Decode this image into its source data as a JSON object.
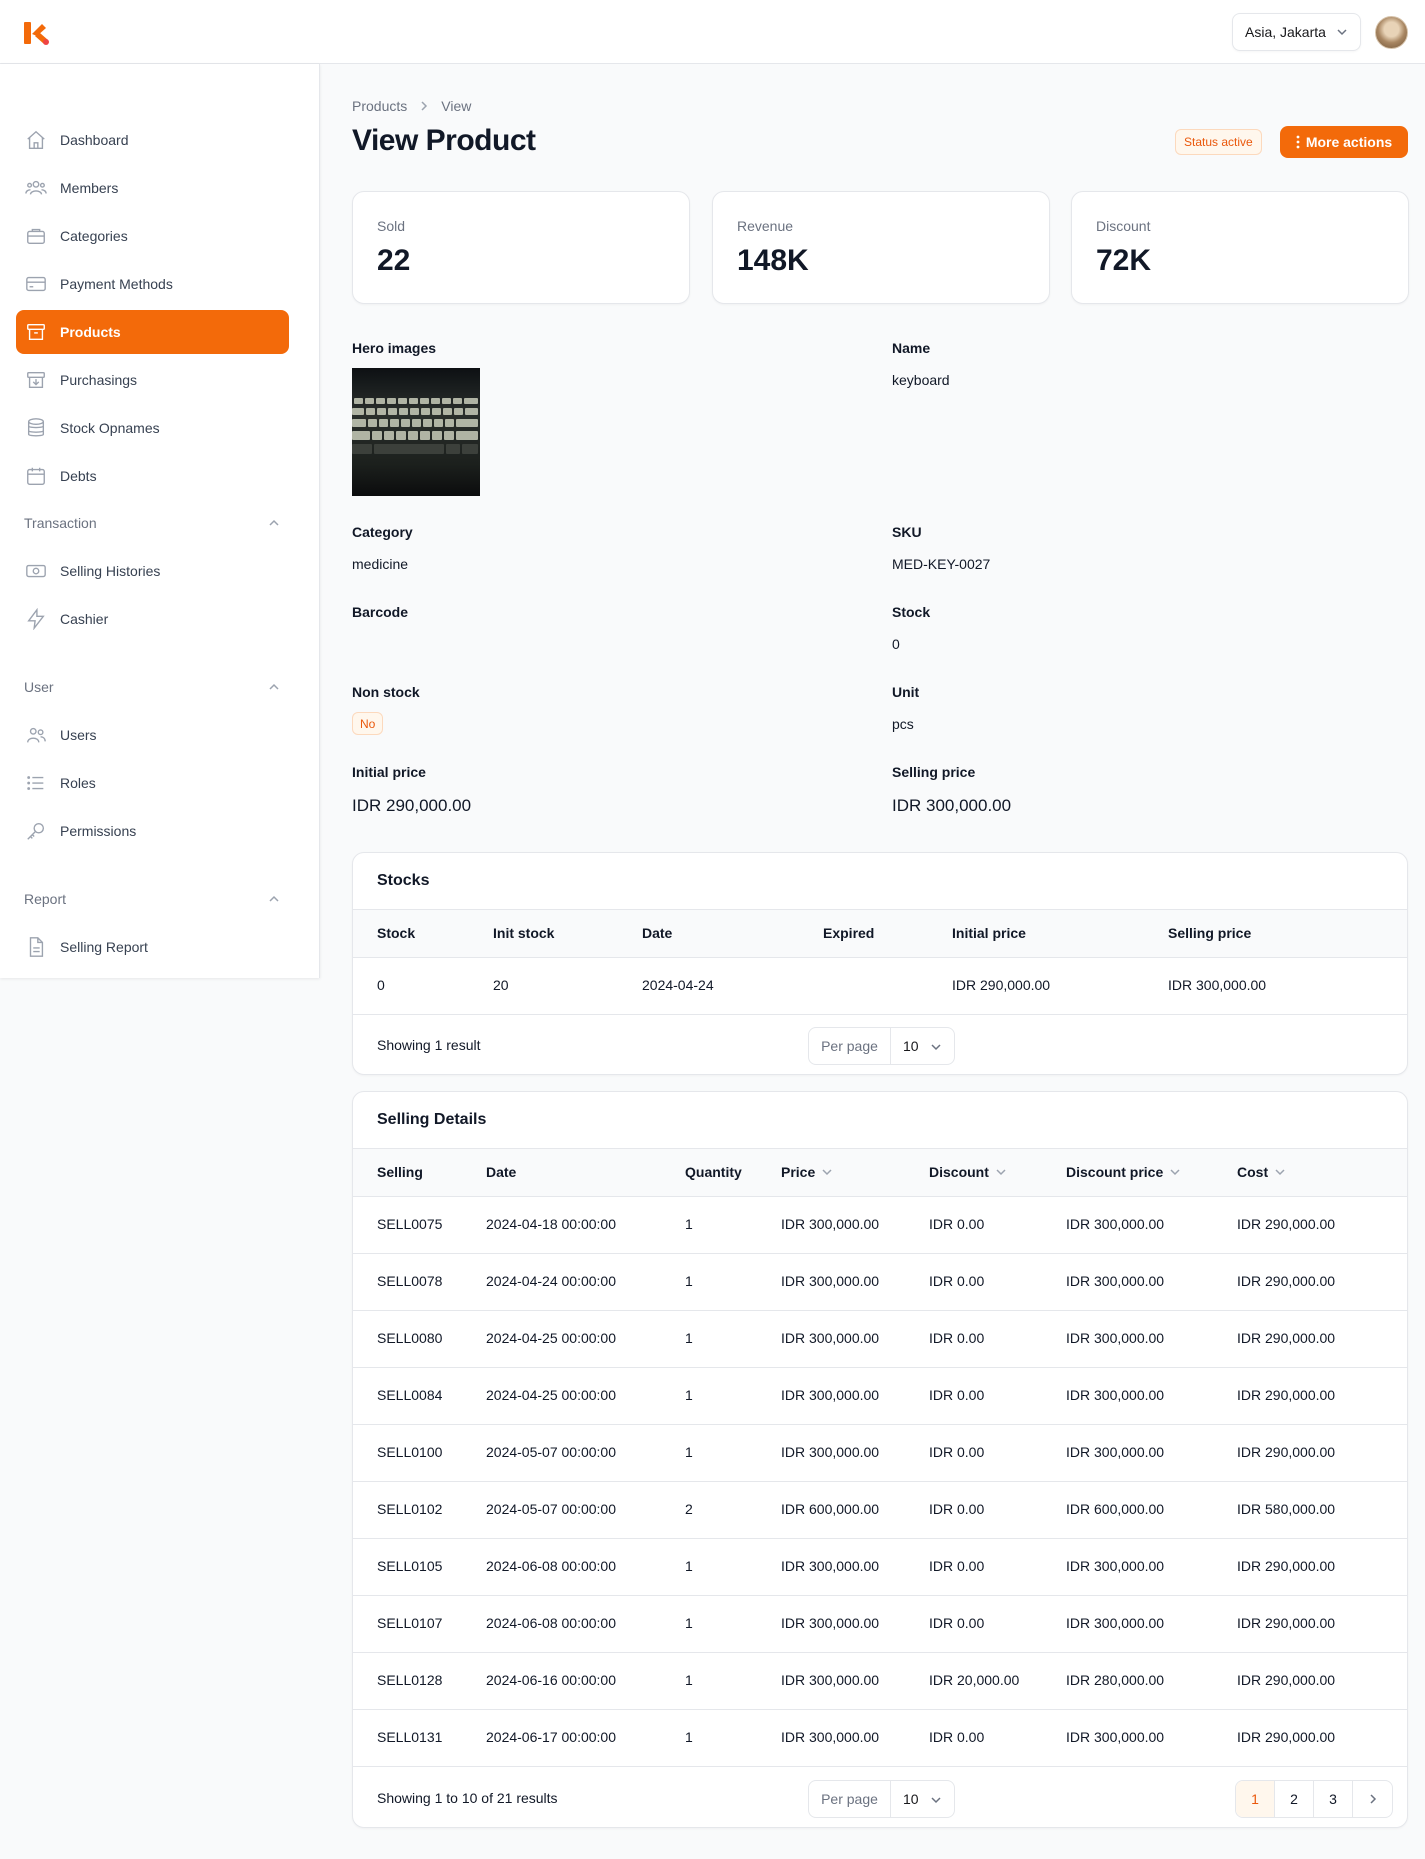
{
  "topbar": {
    "timezone": "Asia, Jakarta"
  },
  "sidebar": {
    "items": [
      {
        "label": "Dashboard"
      },
      {
        "label": "Members"
      },
      {
        "label": "Categories"
      },
      {
        "label": "Payment Methods"
      },
      {
        "label": "Products"
      },
      {
        "label": "Purchasings"
      },
      {
        "label": "Stock Opnames"
      },
      {
        "label": "Debts"
      }
    ],
    "groups": [
      {
        "label": "Transaction",
        "items": [
          {
            "label": "Selling Histories"
          },
          {
            "label": "Cashier"
          }
        ]
      },
      {
        "label": "User",
        "items": [
          {
            "label": "Users"
          },
          {
            "label": "Roles"
          },
          {
            "label": "Permissions"
          }
        ]
      },
      {
        "label": "Report",
        "items": [
          {
            "label": "Selling Report"
          }
        ]
      }
    ],
    "active": "Products",
    "accent": "#f36a0a"
  },
  "breadcrumb": [
    "Products",
    "View"
  ],
  "page": {
    "title": "View Product",
    "status_badge": "Status active",
    "more_actions": "More actions"
  },
  "stats": [
    {
      "label": "Sold",
      "value": "22"
    },
    {
      "label": "Revenue",
      "value": "148K"
    },
    {
      "label": "Discount",
      "value": "72K"
    }
  ],
  "details": {
    "hero_label": "Hero images",
    "name_label": "Name",
    "name": "keyboard",
    "category_label": "Category",
    "category": "medicine",
    "sku_label": "SKU",
    "sku": "MED-KEY-0027",
    "barcode_label": "Barcode",
    "barcode": "",
    "stock_label": "Stock",
    "stock": "0",
    "non_stock_label": "Non stock",
    "non_stock": "No",
    "unit_label": "Unit",
    "unit": "pcs",
    "initial_price_label": "Initial price",
    "initial_price": "IDR 290,000.00",
    "selling_price_label": "Selling price",
    "selling_price": "IDR 300,000.00"
  },
  "stocks": {
    "title": "Stocks",
    "columns": [
      "Stock",
      "Init stock",
      "Date",
      "Expired",
      "Initial price",
      "Selling price"
    ],
    "rows": [
      [
        "0",
        "20",
        "2024-04-24",
        "",
        "IDR 290,000.00",
        "IDR 300,000.00"
      ]
    ],
    "footer": "Showing 1 result",
    "per_page_label": "Per page",
    "per_page": "10"
  },
  "selling": {
    "title": "Selling Details",
    "columns": [
      "Selling",
      "Date",
      "Quantity",
      "Price",
      "Discount",
      "Discount price",
      "Cost"
    ],
    "rows": [
      [
        "SELL0075",
        "2024-04-18 00:00:00",
        "1",
        "IDR 300,000.00",
        "IDR 0.00",
        "IDR 300,000.00",
        "IDR 290,000.00"
      ],
      [
        "SELL0078",
        "2024-04-24 00:00:00",
        "1",
        "IDR 300,000.00",
        "IDR 0.00",
        "IDR 300,000.00",
        "IDR 290,000.00"
      ],
      [
        "SELL0080",
        "2024-04-25 00:00:00",
        "1",
        "IDR 300,000.00",
        "IDR 0.00",
        "IDR 300,000.00",
        "IDR 290,000.00"
      ],
      [
        "SELL0084",
        "2024-04-25 00:00:00",
        "1",
        "IDR 300,000.00",
        "IDR 0.00",
        "IDR 300,000.00",
        "IDR 290,000.00"
      ],
      [
        "SELL0100",
        "2024-05-07 00:00:00",
        "1",
        "IDR 300,000.00",
        "IDR 0.00",
        "IDR 300,000.00",
        "IDR 290,000.00"
      ],
      [
        "SELL0102",
        "2024-05-07 00:00:00",
        "2",
        "IDR 600,000.00",
        "IDR 0.00",
        "IDR 600,000.00",
        "IDR 580,000.00"
      ],
      [
        "SELL0105",
        "2024-06-08 00:00:00",
        "1",
        "IDR 300,000.00",
        "IDR 0.00",
        "IDR 300,000.00",
        "IDR 290,000.00"
      ],
      [
        "SELL0107",
        "2024-06-08 00:00:00",
        "1",
        "IDR 300,000.00",
        "IDR 0.00",
        "IDR 300,000.00",
        "IDR 290,000.00"
      ],
      [
        "SELL0128",
        "2024-06-16 00:00:00",
        "1",
        "IDR 300,000.00",
        "IDR 20,000.00",
        "IDR 280,000.00",
        "IDR 290,000.00"
      ],
      [
        "SELL0131",
        "2024-06-17 00:00:00",
        "1",
        "IDR 300,000.00",
        "IDR 0.00",
        "IDR 300,000.00",
        "IDR 290,000.00"
      ]
    ],
    "footer": "Showing 1 to 10 of 21 results",
    "per_page_label": "Per page",
    "per_page": "10",
    "pages": [
      "1",
      "2",
      "3"
    ],
    "current_page": "1"
  }
}
